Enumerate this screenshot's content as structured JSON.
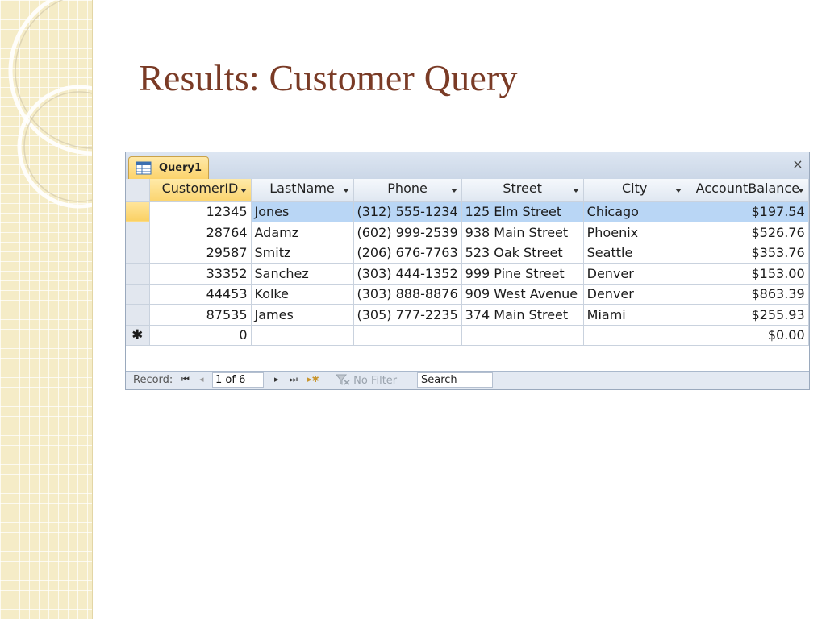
{
  "slide": {
    "title": "Results: Customer Query"
  },
  "window": {
    "tab_label": "Query1",
    "close_symbol": "×"
  },
  "columns": [
    "CustomerID",
    "LastName",
    "Phone",
    "Street",
    "City",
    "AccountBalance"
  ],
  "rows": [
    {
      "customer_id": "12345",
      "last_name": "Jones",
      "phone": "(312) 555-1234",
      "street": "125 Elm Street",
      "city": "Chicago",
      "balance": "$197.54"
    },
    {
      "customer_id": "28764",
      "last_name": "Adamz",
      "phone": "(602) 999-2539",
      "street": "938 Main Street",
      "city": "Phoenix",
      "balance": "$526.76"
    },
    {
      "customer_id": "29587",
      "last_name": "Smitz",
      "phone": "(206) 676-7763",
      "street": "523 Oak Street",
      "city": "Seattle",
      "balance": "$353.76"
    },
    {
      "customer_id": "33352",
      "last_name": "Sanchez",
      "phone": "(303) 444-1352",
      "street": "999 Pine Street",
      "city": "Denver",
      "balance": "$153.00"
    },
    {
      "customer_id": "44453",
      "last_name": "Kolke",
      "phone": "(303) 888-8876",
      "street": "909 West Avenue",
      "city": "Denver",
      "balance": "$863.39"
    },
    {
      "customer_id": "87535",
      "last_name": "James",
      "phone": "(305) 777-2235",
      "street": "374 Main Street",
      "city": "Miami",
      "balance": "$255.93"
    }
  ],
  "new_row": {
    "marker": "✱",
    "customer_id": "0",
    "balance": "$0.00"
  },
  "record_bar": {
    "label": "Record:",
    "first_symbol": "⏮",
    "prev_symbol": "◂",
    "position": "1 of 6",
    "next_symbol": "▸",
    "last_symbol": "⏭",
    "new_symbol": "▸✱",
    "filter_label": "No Filter",
    "search_value": "Search"
  },
  "colors": {
    "title": "#7a3b26",
    "selected_row": "#b9d6f5",
    "active_header": "#fbd46f"
  }
}
